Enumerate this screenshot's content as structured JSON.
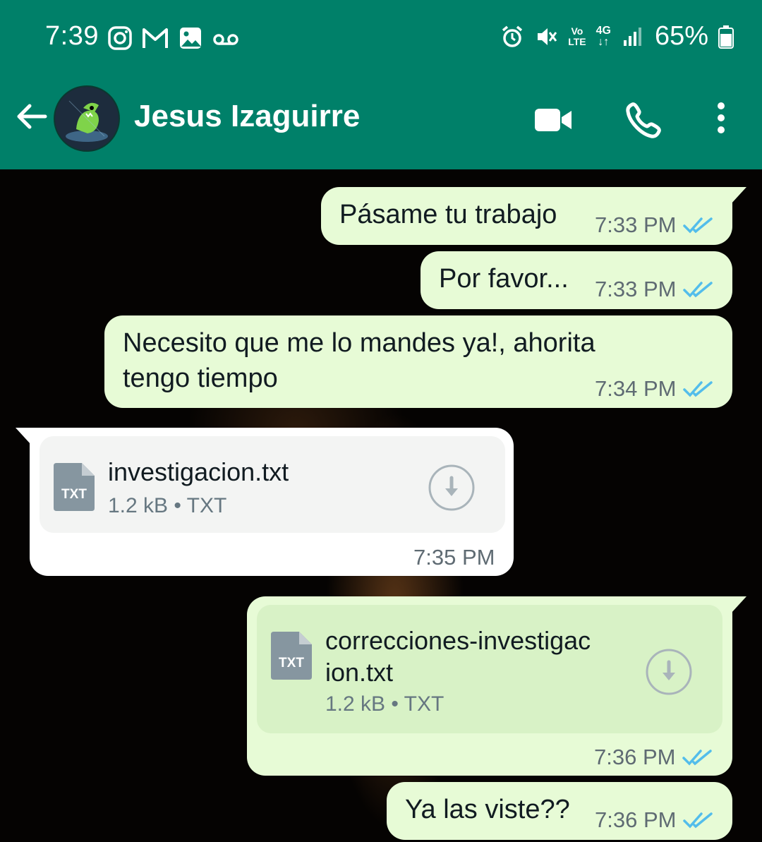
{
  "status": {
    "time": "7:39",
    "battery": "65%",
    "network_top": "4G",
    "volte_top": "Vo",
    "volte_bottom": "LTE"
  },
  "header": {
    "contact_name": "Jesus Izaguirre"
  },
  "messages": [
    {
      "text": "Pásame tu trabajo",
      "time": "7:33 PM"
    },
    {
      "text": "Por favor...",
      "time": "7:33 PM"
    },
    {
      "text_line1": "Necesito que me lo mandes ya!, ahorita",
      "text_line2": "tengo tiempo",
      "time": "7:34 PM"
    },
    {
      "file_name": "investigacion.txt",
      "file_meta": "1.2 kB • TXT",
      "file_badge": "TXT",
      "time": "7:35 PM"
    },
    {
      "file_name_line1": "correcciones-investigac",
      "file_name_line2": "ion.txt",
      "file_meta": "1.2 kB • TXT",
      "file_badge": "TXT",
      "time": "7:36 PM"
    },
    {
      "text": "Ya las viste??",
      "time": "7:36 PM"
    }
  ],
  "colors": {
    "header": "#008069",
    "outgoing_bubble": "#e7fbd6",
    "incoming_bubble": "#ffffff",
    "read_ticks": "#53bdeb"
  }
}
